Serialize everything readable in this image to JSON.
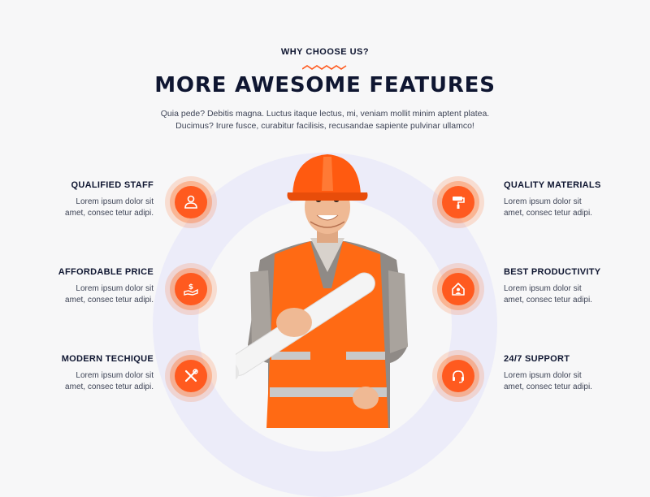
{
  "section": {
    "eyebrow": "WHY CHOOSE US?",
    "title": "MORE AWESOME FEATURES",
    "subtitle_line1": "Quia pede? Debitis magna. Luctus itaque lectus, mi, veniam mollit minim aptent platea.",
    "subtitle_line2": "Ducimus? Irure fusce, curabitur facilisis, recusandae sapiente pulvinar ullamco!"
  },
  "colors": {
    "accent": "#ff5a1f",
    "heading": "#0f1631",
    "ring": "#ececf9"
  },
  "features": {
    "left": [
      {
        "title": "QUALIFIED STAFF",
        "desc1": "Lorem ipsum dolor sit",
        "desc2": "amet, consec tetur adipi.",
        "icon": "staff-icon"
      },
      {
        "title": "AFFORDABLE PRICE",
        "desc1": "Lorem ipsum dolor sit",
        "desc2": "amet, consec tetur adipi.",
        "icon": "price-icon"
      },
      {
        "title": "MODERN TECHIQUE",
        "desc1": "Lorem ipsum dolor sit",
        "desc2": "amet, consec tetur adipi.",
        "icon": "tools-icon"
      }
    ],
    "right": [
      {
        "title": "QUALITY MATERIALS",
        "desc1": "Lorem ipsum dolor sit",
        "desc2": "amet, consec tetur adipi.",
        "icon": "paint-roller-icon"
      },
      {
        "title": "BEST PRODUCTIVITY",
        "desc1": "Lorem ipsum dolor sit",
        "desc2": "amet, consec tetur adipi.",
        "icon": "house-icon"
      },
      {
        "title": "24/7 SUPPORT",
        "desc1": "Lorem ipsum dolor sit",
        "desc2": "amet, consec tetur adipi.",
        "icon": "headset-icon"
      }
    ]
  }
}
